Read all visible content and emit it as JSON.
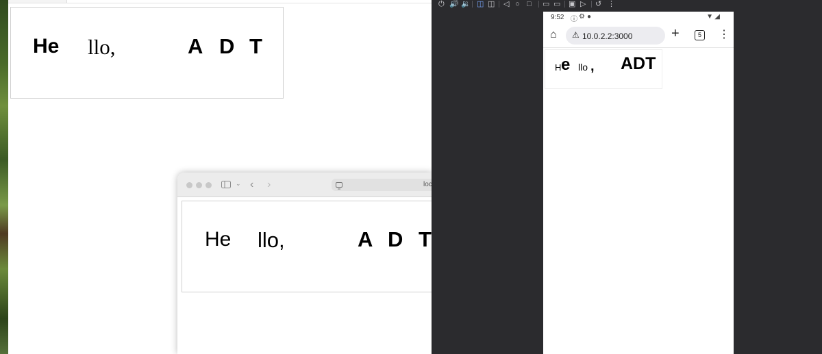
{
  "demo_text": {
    "he": "He",
    "llo": "llo,",
    "a": "A",
    "d": "D",
    "t": "T",
    "mobile_h": "H",
    "mobile_e": "e",
    "mobile_llo": "llo",
    "mobile_comma": ",",
    "mobile_adt": "ADT"
  },
  "safari": {
    "address_text": "loc"
  },
  "emulator": {
    "toolbar_icons": [
      "power-icon",
      "volume-up-icon",
      "volume-down-icon",
      "rotate-left-icon",
      "rotate-right-icon",
      "back-icon",
      "home-icon",
      "overview-icon",
      "fold-icon",
      "fold-alt-icon",
      "camera-icon",
      "record-icon",
      "undo-icon",
      "more-icon"
    ]
  },
  "phone": {
    "status_time": "9:52",
    "url": "10.0.2.2:3000",
    "tab_count": "5"
  }
}
